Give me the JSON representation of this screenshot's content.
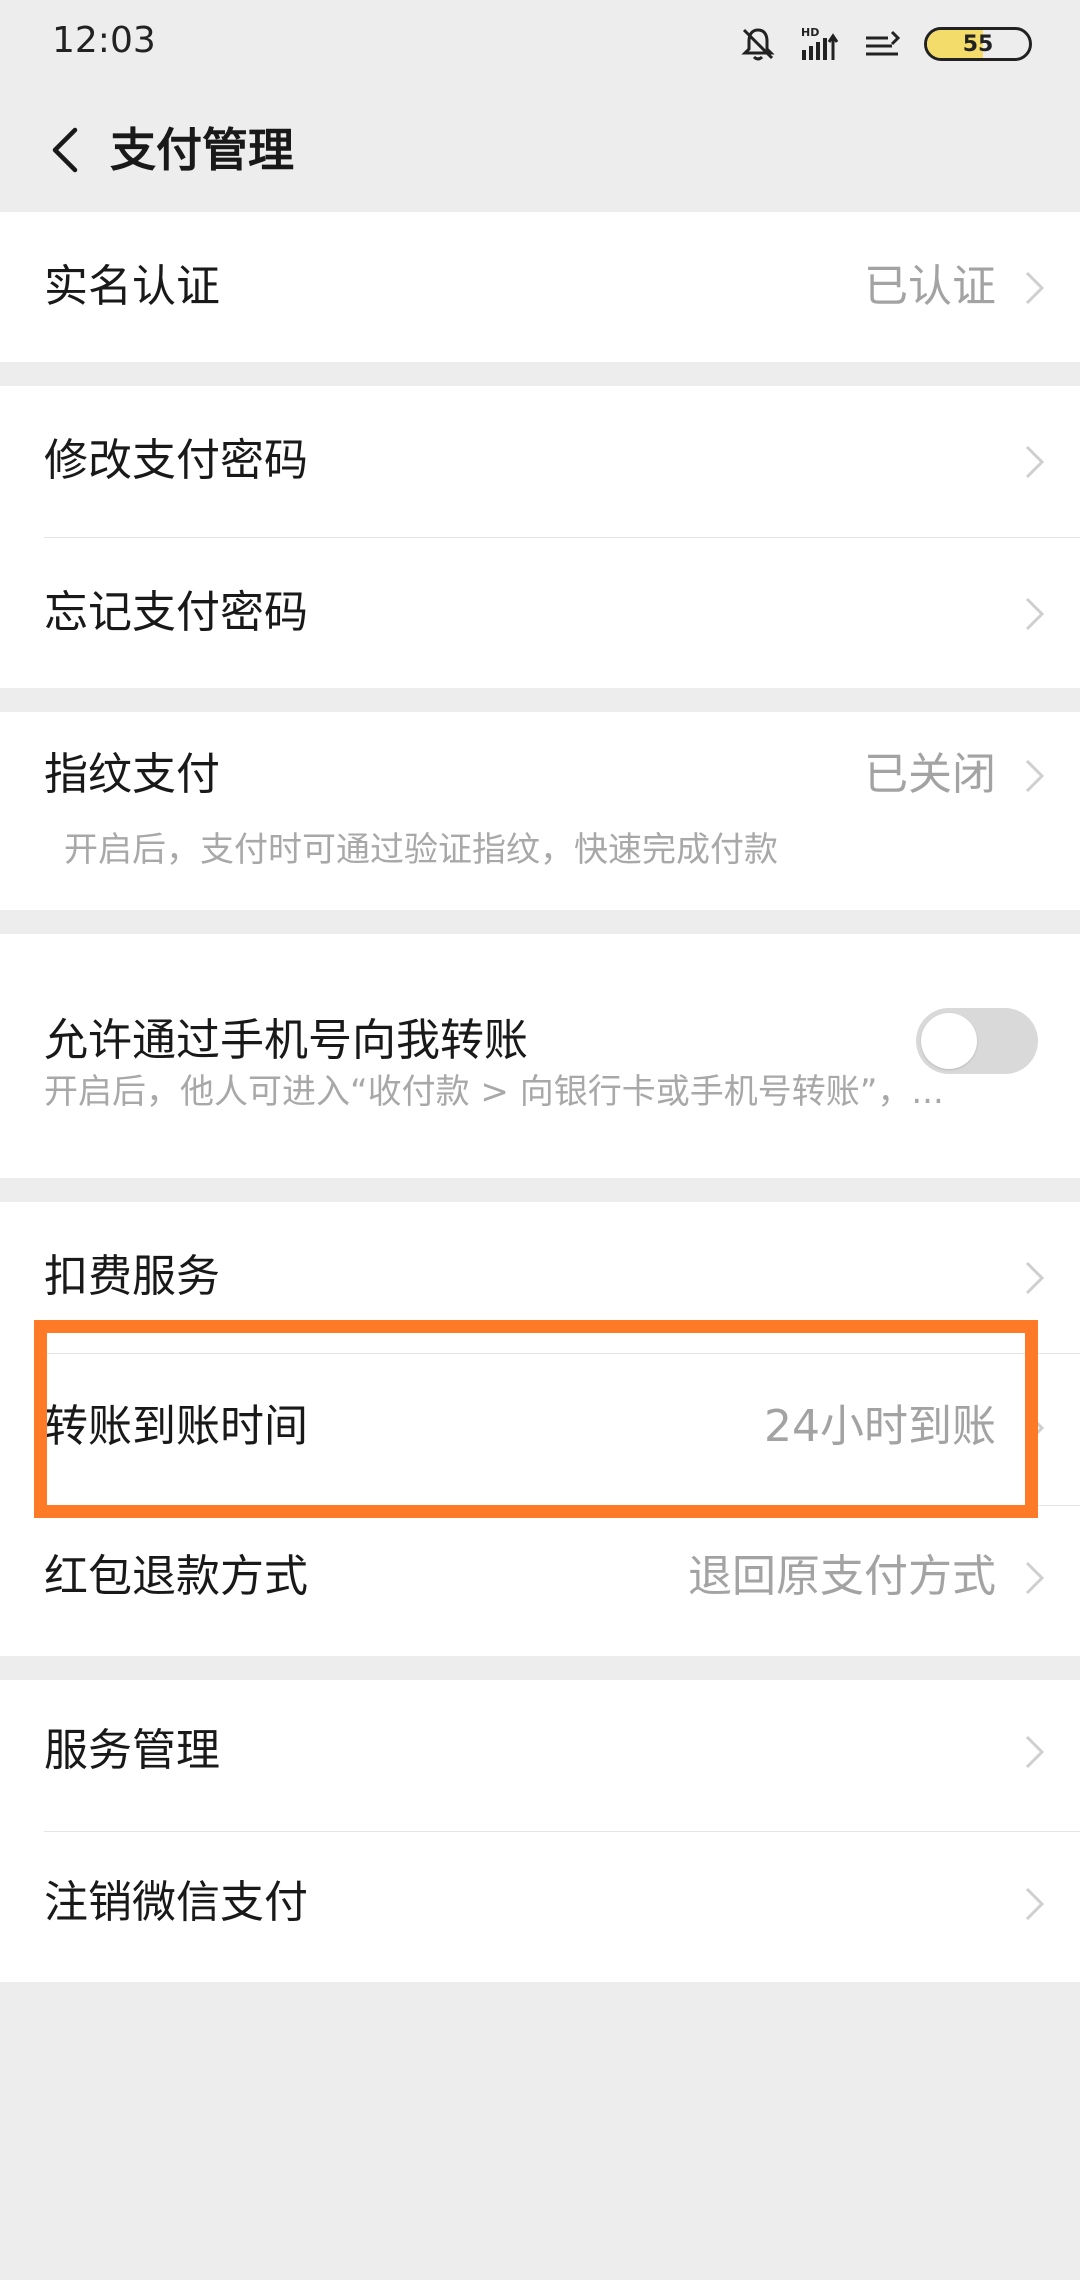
{
  "status_bar": {
    "time": "12:03",
    "battery_level": "55",
    "icons": [
      "bell-mute-icon",
      "hd-signal-icon",
      "wifi-icon",
      "battery-icon"
    ]
  },
  "nav": {
    "back_icon": "chevron-left-icon",
    "title": "支付管理"
  },
  "groups": {
    "verify": {
      "label": "实名认证",
      "value": "已认证"
    },
    "password": {
      "modify": "修改支付密码",
      "forget": "忘记支付密码"
    },
    "fingerprint": {
      "label": "指纹支付",
      "value": "已关闭",
      "description": "开启后，支付时可通过验证指纹，快速完成付款"
    },
    "phone_transfer": {
      "label": "允许通过手机号向我转账",
      "description": "开启后，他人可进入“收付款 > 向银行卡或手机号转账”，...",
      "toggle_on": false
    },
    "services": {
      "deduction": "扣费服务",
      "transfer_time_label": "转账到账时间",
      "transfer_time_value": "24小时到账",
      "redpacket_label": "红包退款方式",
      "redpacket_value": "退回原支付方式"
    },
    "manage": {
      "service_manage": "服务管理",
      "cancel_pay": "注销微信支付"
    }
  },
  "colors": {
    "background": "#ededed",
    "card": "#ffffff",
    "highlight": "#ff7a27",
    "secondary_text": "#a3a3a3",
    "toggle_off": "#d9d9d9"
  }
}
